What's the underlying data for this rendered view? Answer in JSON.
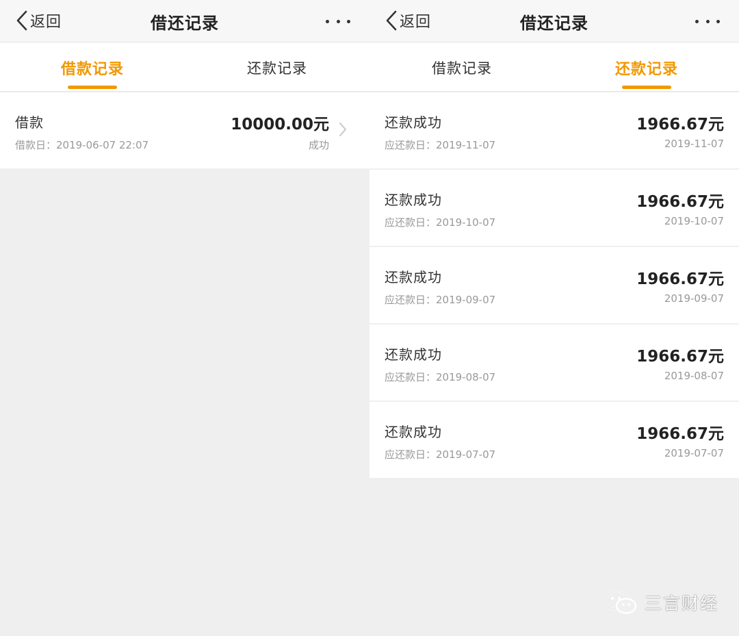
{
  "colors": {
    "accent": "#f39800",
    "background": "#efefef",
    "card": "#ffffff",
    "text_primary": "#333333",
    "text_secondary": "#999999"
  },
  "left_screen": {
    "nav": {
      "back_label": "返回",
      "title": "借还记录",
      "back_icon": "chevron-left-icon",
      "more_icon": "more-dots-icon"
    },
    "tabs": [
      {
        "label": "借款记录",
        "active": true
      },
      {
        "label": "还款记录",
        "active": false
      }
    ],
    "loans": [
      {
        "title": "借款",
        "date_label": "借款日：2019-06-07 22:07",
        "amount": "10000.00元",
        "status": "成功",
        "chevron_icon": "chevron-right-icon"
      }
    ]
  },
  "right_screen": {
    "nav": {
      "back_label": "返回",
      "title": "借还记录",
      "back_icon": "chevron-left-icon",
      "more_icon": "more-dots-icon"
    },
    "tabs": [
      {
        "label": "借款记录",
        "active": false
      },
      {
        "label": "还款记录",
        "active": true
      }
    ],
    "repayments": [
      {
        "title": "还款成功",
        "due_label": "应还款日：2019-11-07",
        "amount": "1966.67元",
        "date": "2019-11-07"
      },
      {
        "title": "还款成功",
        "due_label": "应还款日：2019-10-07",
        "amount": "1966.67元",
        "date": "2019-10-07"
      },
      {
        "title": "还款成功",
        "due_label": "应还款日：2019-09-07",
        "amount": "1966.67元",
        "date": "2019-09-07"
      },
      {
        "title": "还款成功",
        "due_label": "应还款日：2019-08-07",
        "amount": "1966.67元",
        "date": "2019-08-07"
      },
      {
        "title": "还款成功",
        "due_label": "应还款日：2019-07-07",
        "amount": "1966.67元",
        "date": "2019-07-07"
      }
    ]
  },
  "watermark": {
    "text": "三言财经",
    "icon": "wechat-icon"
  }
}
